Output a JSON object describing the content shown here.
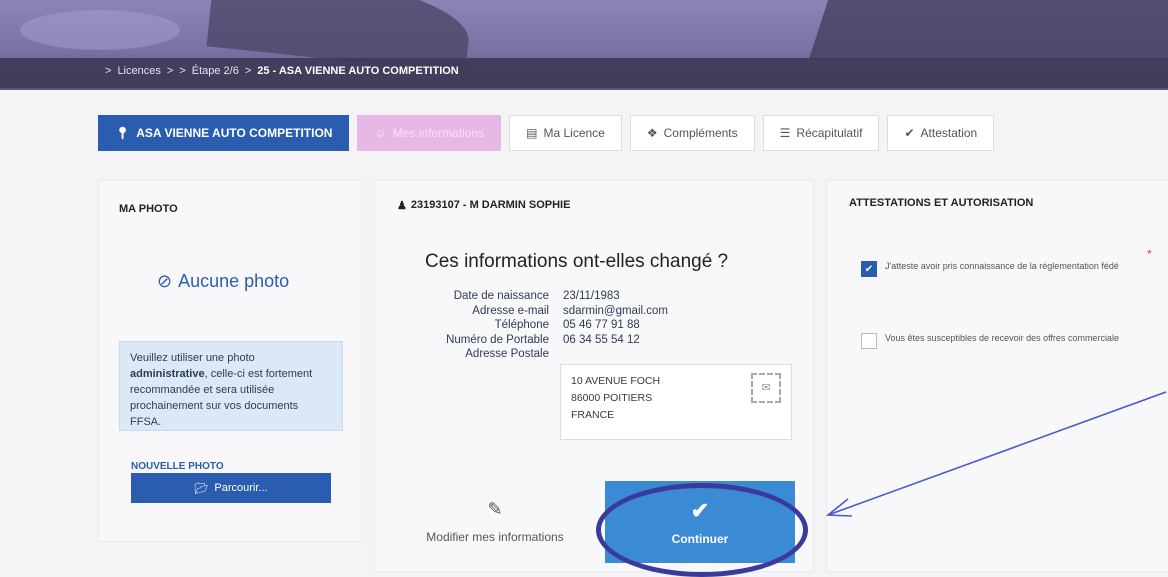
{
  "breadcrumb": {
    "items": [
      "Licences",
      "Étape 2/6"
    ],
    "current": "25 - ASA VIENNE AUTO COMPETITION",
    "separator": ">"
  },
  "tabs": [
    {
      "label": "ASA VIENNE AUTO COMPETITION",
      "icon": "map-marker-icon",
      "state": "active"
    },
    {
      "label": "Mes informations",
      "icon": "user-icon",
      "state": "disabled"
    },
    {
      "label": "Ma Licence",
      "icon": "id-card-icon",
      "state": "normal"
    },
    {
      "label": "Compléments",
      "icon": "puzzle-icon",
      "state": "normal"
    },
    {
      "label": "Récapitulatif",
      "icon": "list-icon",
      "state": "normal"
    },
    {
      "label": "Attestation",
      "icon": "check-circle-icon",
      "state": "normal"
    }
  ],
  "photo": {
    "title": "MA PHOTO",
    "no_photo": "Aucune photo",
    "info_before": "Veuillez utiliser une photo ",
    "info_bold": "administrative",
    "info_after": ", celle-ci est fortement recommandée et sera utilisée prochainement sur vos documents FFSA.",
    "new_photo_label": "NOUVELLE PHOTO",
    "browse_label": "Parcourir..."
  },
  "profile": {
    "user": "23193107 - M DARMIN SOPHIE",
    "heading": "Ces informations ont-elles changé ?",
    "fields": [
      {
        "label": "Date de naissance",
        "value": "23/11/1983"
      },
      {
        "label": "Adresse e-mail",
        "value": "sdarmin@gmail.com"
      },
      {
        "label": "Téléphone",
        "value": "05 46 77 91 88"
      },
      {
        "label": "Numéro de Portable",
        "value": "06 34 55 54 12"
      },
      {
        "label": "Adresse Postale",
        "value": ""
      }
    ],
    "address": [
      "10 AVENUE FOCH",
      "86000 POITIERS",
      "FRANCE"
    ],
    "edit_label": "Modifier mes informations",
    "continue_label": "Continuer"
  },
  "attestations": {
    "title": "ATTESTATIONS ET AUTORISATION",
    "items": [
      {
        "text": "J'atteste avoir pris connaissance de la réglementation fédé",
        "checked": true,
        "required": true
      },
      {
        "text": "Vous êtes susceptibles de recevoir des offres commerciale",
        "checked": false,
        "required": false
      }
    ]
  },
  "colors": {
    "primary": "#2a5db0",
    "continue": "#3b8ad4",
    "annotation": "#3a3a9d",
    "banner": "#8d83b6"
  }
}
